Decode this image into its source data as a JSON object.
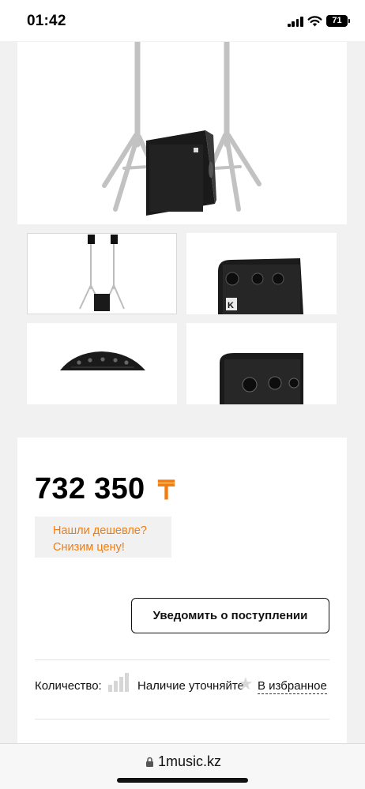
{
  "status_bar": {
    "time": "01:42",
    "battery": "71"
  },
  "product": {
    "main_image_icon": "speaker-on-stands",
    "thumbnails": [
      {
        "icon": "speakers-on-stands-with-sub"
      },
      {
        "icon": "amp-panel-closeup"
      },
      {
        "icon": "control-strip"
      },
      {
        "icon": "input-panel-closeup"
      }
    ]
  },
  "price_block": {
    "price": "732 350",
    "currency": "₸",
    "cheaper_line1": "Нашли дешевле?",
    "cheaper_line2": "Снизим цену!",
    "notify_label": "Уведомить о поступлении",
    "quantity_label": "Количество:",
    "availability": "Наличие уточняйте",
    "favorites": "В избранное"
  },
  "browser": {
    "url": "1music.kz"
  },
  "colors": {
    "accent": "#ef7d13",
    "background": "#f1f1f1"
  }
}
